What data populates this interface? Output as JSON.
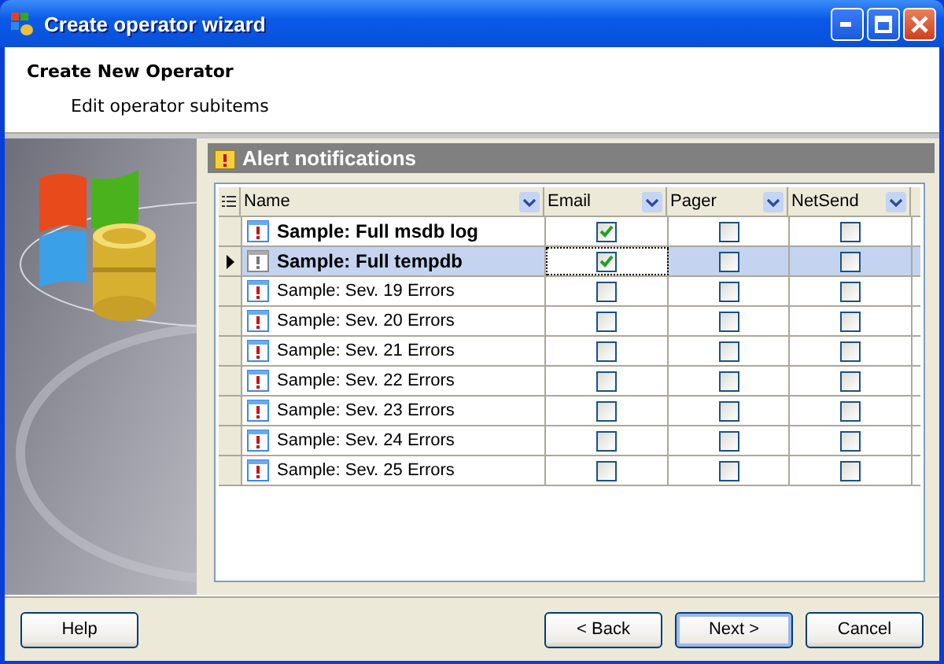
{
  "window": {
    "title": "Create operator wizard"
  },
  "header": {
    "title": "Create New Operator",
    "subtitle": "Edit operator subitems"
  },
  "panel": {
    "title": "Alert notifications"
  },
  "table": {
    "columns": [
      "Name",
      "Email",
      "Pager",
      "NetSend"
    ],
    "rows": [
      {
        "name": "Sample: Full msdb log",
        "bold": true,
        "selected": false,
        "email": true,
        "pager": false,
        "netsend": false
      },
      {
        "name": "Sample: Full tempdb",
        "bold": true,
        "selected": true,
        "email": true,
        "pager": false,
        "netsend": false
      },
      {
        "name": "Sample: Sev. 19 Errors",
        "bold": false,
        "selected": false,
        "email": false,
        "pager": false,
        "netsend": false
      },
      {
        "name": "Sample: Sev. 20 Errors",
        "bold": false,
        "selected": false,
        "email": false,
        "pager": false,
        "netsend": false
      },
      {
        "name": "Sample: Sev. 21 Errors",
        "bold": false,
        "selected": false,
        "email": false,
        "pager": false,
        "netsend": false
      },
      {
        "name": "Sample: Sev. 22 Errors",
        "bold": false,
        "selected": false,
        "email": false,
        "pager": false,
        "netsend": false
      },
      {
        "name": "Sample: Sev. 23 Errors",
        "bold": false,
        "selected": false,
        "email": false,
        "pager": false,
        "netsend": false
      },
      {
        "name": "Sample: Sev. 24 Errors",
        "bold": false,
        "selected": false,
        "email": false,
        "pager": false,
        "netsend": false
      },
      {
        "name": "Sample: Sev. 25 Errors",
        "bold": false,
        "selected": false,
        "email": false,
        "pager": false,
        "netsend": false
      }
    ]
  },
  "buttons": [
    {
      "label": "Help",
      "kind": "help"
    },
    {
      "label": "< Back",
      "kind": "back"
    },
    {
      "label": "Next >",
      "kind": "default"
    },
    {
      "label": "Cancel",
      "kind": "normal"
    }
  ]
}
